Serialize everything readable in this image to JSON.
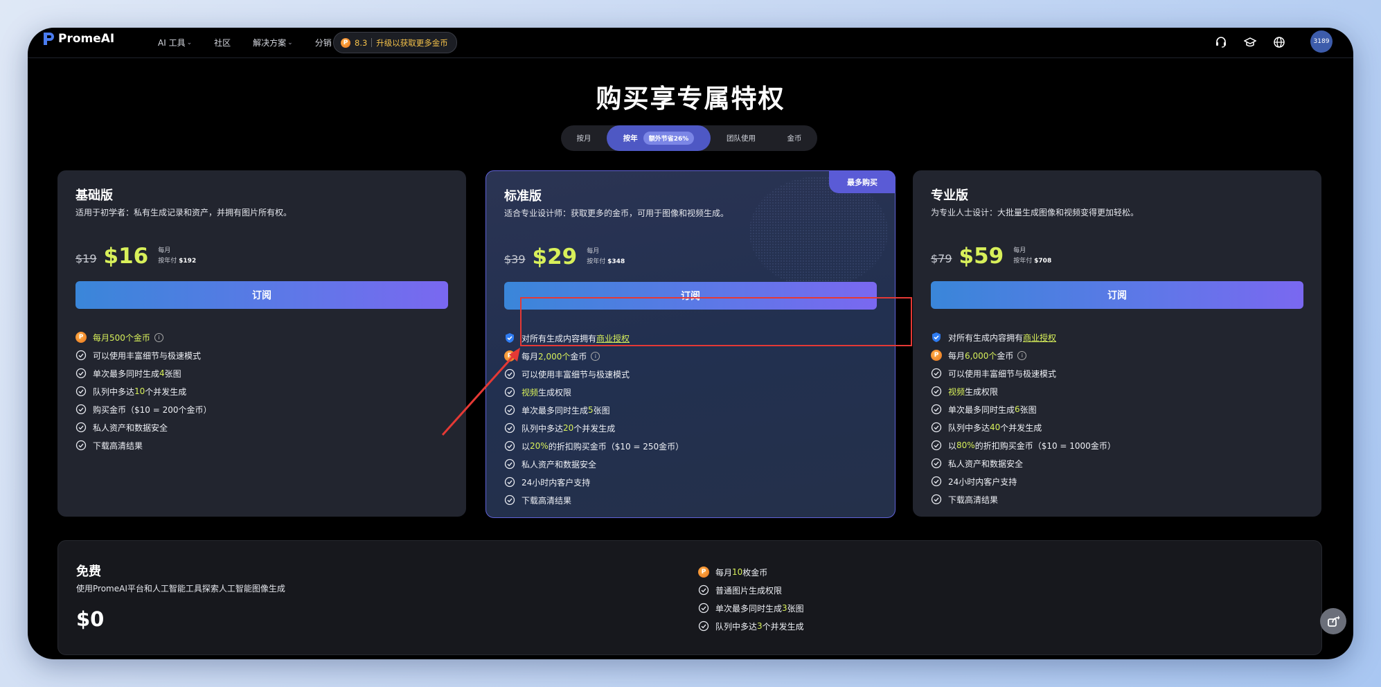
{
  "nav": {
    "brand": "PromeAI",
    "links": [
      {
        "label": "AI 工具",
        "dropdown": true
      },
      {
        "label": "社区",
        "dropdown": false
      },
      {
        "label": "解决方案",
        "dropdown": true
      },
      {
        "label": "分销",
        "dropdown": false
      }
    ],
    "coin_balance": "8.3",
    "upgrade_text": "升级以获取更多金币",
    "icons": [
      "headset-icon",
      "graduation-cap-icon",
      "globe-icon"
    ],
    "avatar_text": "3189"
  },
  "title": "购买享专属特权",
  "billing_tabs": [
    {
      "label": "按月",
      "active": false
    },
    {
      "label": "按年",
      "active": true,
      "badge": "额外节省26%"
    },
    {
      "label": "团队使用",
      "active": false
    },
    {
      "label": "金币",
      "active": false
    }
  ],
  "plans": [
    {
      "name": "基础版",
      "description": "适用于初学者：私有生成记录和资产，并拥有图片所有权。",
      "old_price": "$19",
      "price": "$16",
      "period": "每月",
      "yearly_prefix": "按年付",
      "yearly_amount": "$192",
      "button": "订阅",
      "features": [
        [
          "",
          "每月500个金币",
          ""
        ],
        [
          "可以使用丰富细节与极速模式",
          "",
          ""
        ],
        [
          "单次最多同时生成",
          "4",
          "张图"
        ],
        [
          "队列中多达",
          "10",
          "个并发生成"
        ],
        [
          "购买金币（$10 = 200个金币）",
          "",
          ""
        ],
        [
          "私人资产和数据安全",
          "",
          ""
        ],
        [
          "下载高清结果",
          "",
          ""
        ]
      ]
    },
    {
      "name": "标准版",
      "tag": "最多购买",
      "description": "适合专业设计师：获取更多的金币，可用于图像和视频生成。",
      "old_price": "$39",
      "price": "$29",
      "period": "每月",
      "yearly_prefix": "按年付",
      "yearly_amount": "$348",
      "button": "订阅",
      "features": [
        [
          "对所有生成内容拥有",
          "商业授权",
          ""
        ],
        [
          "每月",
          "2,000个",
          "金币"
        ],
        [
          "可以使用丰富细节与极速模式",
          "",
          ""
        ],
        [
          "",
          "视频",
          "生成权限"
        ],
        [
          "单次最多同时生成",
          "5",
          "张图"
        ],
        [
          "队列中多达",
          "20",
          "个并发生成"
        ],
        [
          "以",
          "20%",
          "的折扣购买金币（$10 = 250金币）"
        ],
        [
          "私人资产和数据安全",
          "",
          ""
        ],
        [
          "24小时内客户支持",
          "",
          ""
        ],
        [
          "下载高清结果",
          "",
          ""
        ]
      ]
    },
    {
      "name": "专业版",
      "description": "为专业人士设计：大批量生成图像和视频变得更加轻松。",
      "old_price": "$79",
      "price": "$59",
      "period": "每月",
      "yearly_prefix": "按年付",
      "yearly_amount": "$708",
      "button": "订阅",
      "features": [
        [
          "对所有生成内容拥有",
          "商业授权",
          ""
        ],
        [
          "每月",
          "6,000个",
          "金币"
        ],
        [
          "可以使用丰富细节与极速模式",
          "",
          ""
        ],
        [
          "",
          "视频",
          "生成权限"
        ],
        [
          "单次最多同时生成",
          "6",
          "张图"
        ],
        [
          "队列中多达",
          "40",
          "个并发生成"
        ],
        [
          "以",
          "80%",
          "的折扣购买金币（$10 = 1000金币）"
        ],
        [
          "私人资产和数据安全",
          "",
          ""
        ],
        [
          "24小时内客户支持",
          "",
          ""
        ],
        [
          "下载高清结果",
          "",
          ""
        ]
      ]
    }
  ],
  "free": {
    "name": "免费",
    "description": "使用PromeAI平台和人工智能工具探索人工智能图像生成",
    "price": "$0",
    "features": [
      [
        "每月",
        "10",
        "枚金币"
      ],
      [
        "普通图片生成权限",
        "",
        ""
      ],
      [
        "单次最多同时生成",
        "3",
        "张图"
      ],
      [
        "队列中多达",
        "3",
        "个并发生成"
      ]
    ]
  },
  "colors": {
    "accent_green": "#d8f05a",
    "primary_purple": "#5a5bd6",
    "annotation_red": "#e53935"
  }
}
